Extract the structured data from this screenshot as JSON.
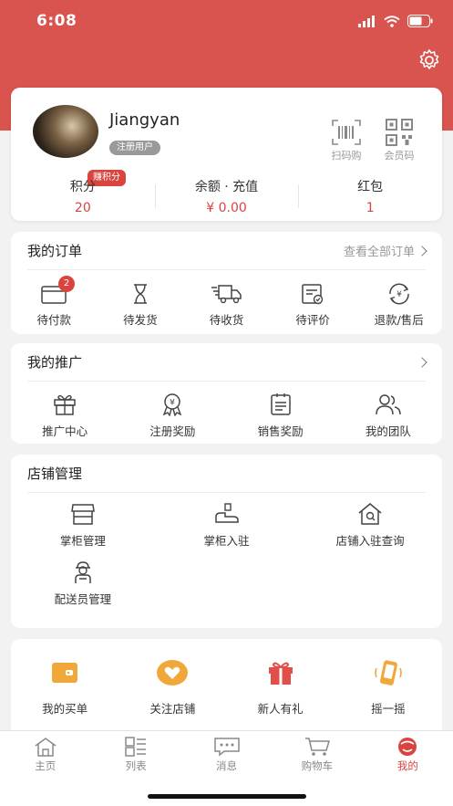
{
  "status": {
    "time": "6:08"
  },
  "profile": {
    "username": "Jiangyan",
    "role": "注册用户",
    "scan_label": "扫码购",
    "member_code_label": "会员码",
    "earn_badge": "赚积分",
    "stats": [
      {
        "label": "积分",
        "value": "20"
      },
      {
        "label": "余额 · 充值",
        "value": "¥ 0.00"
      },
      {
        "label": "红包",
        "value": "1"
      }
    ]
  },
  "orders": {
    "title": "我的订单",
    "view_all": "查看全部订单",
    "items": [
      {
        "label": "待付款",
        "icon": "wallet-icon",
        "badge": "2"
      },
      {
        "label": "待发货",
        "icon": "hourglass-icon"
      },
      {
        "label": "待收货",
        "icon": "delivery-truck-icon"
      },
      {
        "label": "待评价",
        "icon": "review-icon"
      },
      {
        "label": "退款/售后",
        "icon": "refund-icon"
      }
    ]
  },
  "promotion": {
    "title": "我的推广",
    "items": [
      {
        "label": "推广中心",
        "icon": "gift-box-icon"
      },
      {
        "label": "注册奖励",
        "icon": "award-ribbon-icon"
      },
      {
        "label": "销售奖励",
        "icon": "clipboard-list-icon"
      },
      {
        "label": "我的团队",
        "icon": "team-icon"
      }
    ]
  },
  "store": {
    "title": "店铺管理",
    "items": [
      {
        "label": "掌柜管理",
        "icon": "storefront-icon"
      },
      {
        "label": "掌柜入驻",
        "icon": "register-hand-icon"
      },
      {
        "label": "店铺入驻查询",
        "icon": "house-search-icon"
      },
      {
        "label": "配送员管理",
        "icon": "courier-icon"
      }
    ]
  },
  "extras": {
    "items": [
      {
        "label": "我的买单",
        "icon": "payment-card-icon"
      },
      {
        "label": "关注店铺",
        "icon": "heart-icon"
      },
      {
        "label": "新人有礼",
        "icon": "red-gift-icon"
      },
      {
        "label": "摇一摇",
        "icon": "shake-phone-icon"
      }
    ]
  },
  "tabbar": {
    "tabs": [
      {
        "label": "主页",
        "icon": "home-icon"
      },
      {
        "label": "列表",
        "icon": "list-grid-icon"
      },
      {
        "label": "消息",
        "icon": "message-icon"
      },
      {
        "label": "购物车",
        "icon": "cart-icon"
      },
      {
        "label": "我的",
        "icon": "profile-face-icon",
        "active": true
      }
    ]
  },
  "colors": {
    "brand": "#d9534f",
    "accent": "#d9443f",
    "orange": "#f0a83a"
  }
}
